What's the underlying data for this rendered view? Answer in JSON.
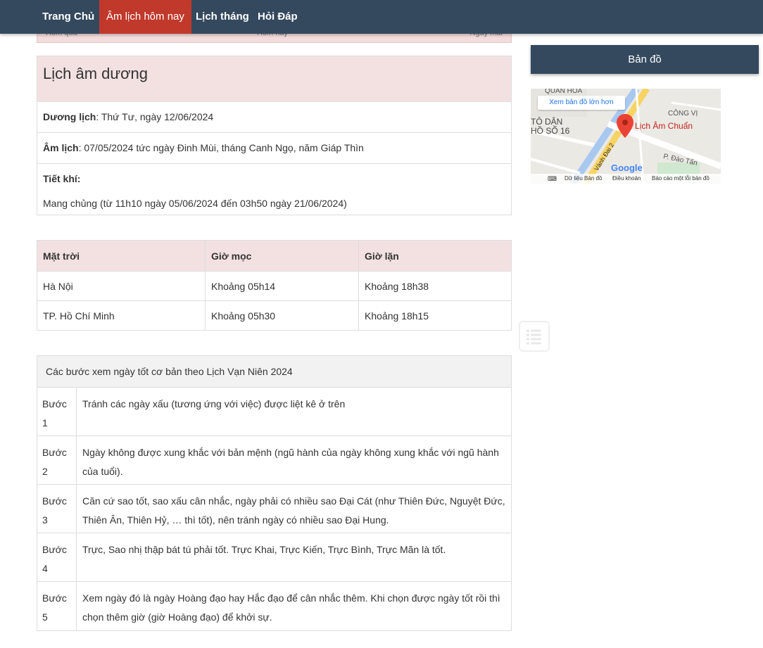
{
  "nav": {
    "items": [
      {
        "label": "Trang Chủ"
      },
      {
        "label": "Âm lịch hôm nay"
      },
      {
        "label": "Lịch tháng"
      },
      {
        "label": "Hỏi Đáp"
      }
    ]
  },
  "day_strip": {
    "prev": "Hôm qua",
    "today": "Hôm nay",
    "next": "Ngày mai"
  },
  "calendar": {
    "title": "Lịch âm dương",
    "duong_label": "Dương lịch",
    "duong_value": ": Thứ Tư, ngày 12/06/2024",
    "am_label": "Âm lịch",
    "am_value": ": 07/05/2024 tức ngày Đinh Mùi, tháng Canh Ngọ, năm Giáp Thìn",
    "tietkhi_label": "Tiết khí:",
    "tietkhi_value": "Mang chủng (từ 11h10 ngày 05/06/2024 đến 03h50 ngày 21/06/2024)"
  },
  "sun": {
    "headers": [
      "Mặt trời",
      "Giờ mọc",
      "Giờ lặn"
    ],
    "rows": [
      [
        "Hà Nội",
        "Khoảng 05h14",
        "Khoảng 18h38"
      ],
      [
        "TP. Hồ Chí Minh",
        "Khoảng 05h30",
        "Khoảng 18h15"
      ]
    ]
  },
  "steps": {
    "title": "Các bước xem ngày tốt cơ bản theo Lịch Vạn Niên 2024",
    "rows": [
      {
        "num": "Bước 1",
        "text": "Tránh các ngày xấu (tương ứng với việc) được liệt kê ở trên"
      },
      {
        "num": "Bước 2",
        "text": "Ngày không được xung khắc với bản mệnh (ngũ hành của ngày không xung khắc với ngũ hành của tuổi)."
      },
      {
        "num": "Bước 3",
        "text": "Căn cứ sao tốt, sao xấu cân nhắc, ngày phải có nhiều sao Đại Cát (như Thiên Đức, Nguyệt Đức, Thiên Ân, Thiên Hỷ, … thì tốt), nên tránh ngày có nhiều sao Đại Hung."
      },
      {
        "num": "Bước 4",
        "text": "Trực, Sao nhị thập bát tú phải tốt. Trực Khai, Trực Kiến, Trực Bình, Trực Mãn là tốt."
      },
      {
        "num": "Bước 5",
        "text": "Xem ngày đó là ngày Hoàng đạo hay Hắc đạo để cân nhắc thêm. Khi chọn được ngày tốt rồi thì chọn thêm giờ (giờ Hoàng đạo) để khởi sự."
      }
    ]
  },
  "sidebar": {
    "map_button": "Bản đồ",
    "map_link": "Xem bản đồ lớn hơn",
    "map_place": "Lịch Âm Chuẩn",
    "map_labels": [
      "QUAN HOA",
      "CÔNG VỊ",
      "TÔ DẬN",
      "HỒ SỐ 16",
      "P. Đào Tấn",
      "Vành Đai 2"
    ],
    "map_google": "Google",
    "map_footer": [
      "Dữ liệu Bản đồ",
      "Điều khoản",
      "Báo cáo một lỗi bản đồ"
    ]
  },
  "colors": {
    "nav_bg": "#34495e",
    "nav_active": "#c0392b",
    "header_pink": "#f3e1e1"
  },
  "icons": {
    "toc": "list-icon",
    "pin": "map-pin-icon",
    "keyboard": "keyboard-icon"
  }
}
